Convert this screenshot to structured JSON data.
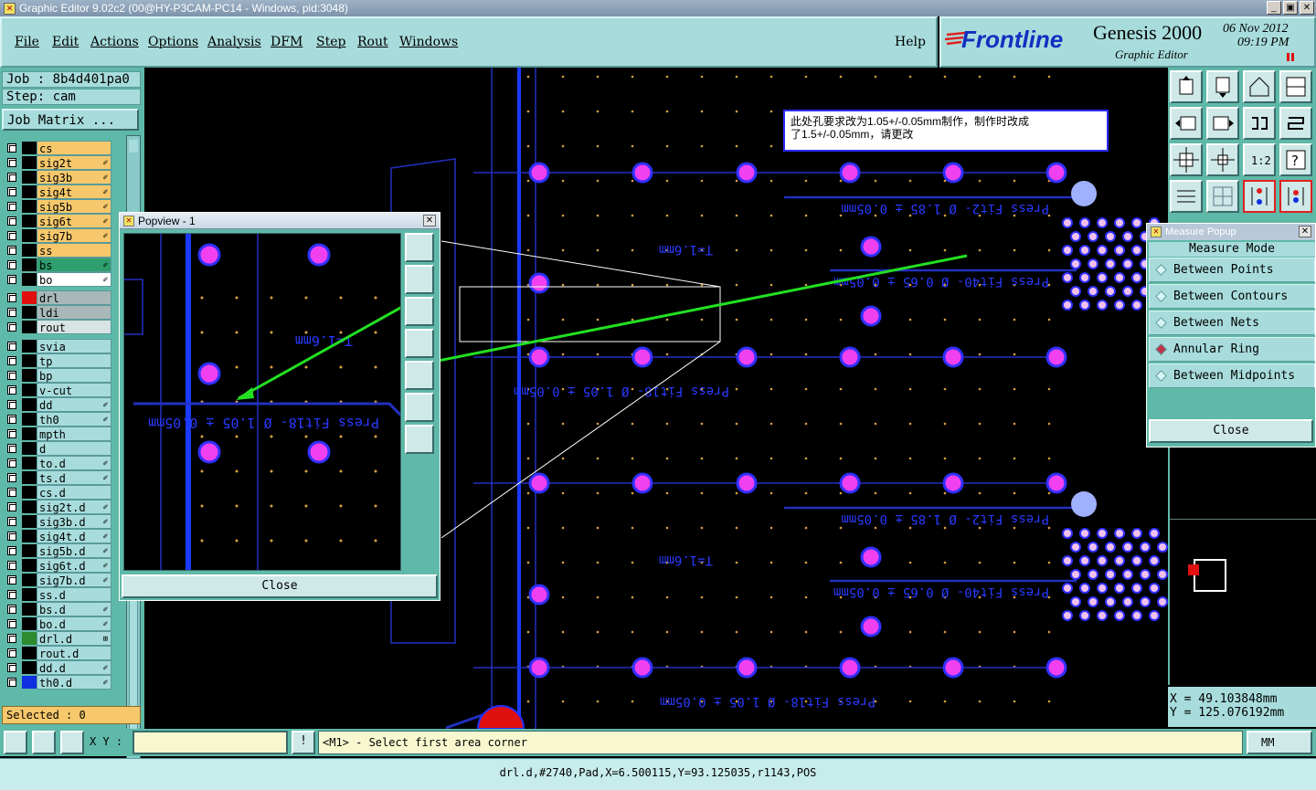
{
  "window": {
    "title": "Graphic Editor 9.02c2 (00@HY-P3CAM-PC14 - Windows, pid:3048)",
    "buttons": [
      "_",
      "▣",
      "✕"
    ]
  },
  "menu": {
    "items": [
      "File",
      "Edit",
      "Actions",
      "Options",
      "Analysis",
      "DFM",
      "Step",
      "Rout",
      "Windows"
    ],
    "help": "Help"
  },
  "brand": {
    "logo": "Frontline",
    "product": "Genesis 2000",
    "subtitle": "Graphic Editor",
    "date": "06 Nov 2012",
    "time": "09:19 PM"
  },
  "job": {
    "job_label": "Job : 8b4d401pa0",
    "step_label": "Step: cam",
    "matrix_button": "Job Matrix ..."
  },
  "layers": [
    {
      "name": "cs",
      "color": "#f7c86b",
      "swatch": "#000",
      "mark": ""
    },
    {
      "name": "sig2t",
      "color": "#f7c86b",
      "swatch": "#000",
      "mark": "✐"
    },
    {
      "name": "sig3b",
      "color": "#f7c86b",
      "swatch": "#000",
      "mark": "✐"
    },
    {
      "name": "sig4t",
      "color": "#f7c86b",
      "swatch": "#000",
      "mark": "✐"
    },
    {
      "name": "sig5b",
      "color": "#f7c86b",
      "swatch": "#000",
      "mark": "✐"
    },
    {
      "name": "sig6t",
      "color": "#f7c86b",
      "swatch": "#000",
      "mark": "✐"
    },
    {
      "name": "sig7b",
      "color": "#f7c86b",
      "swatch": "#000",
      "mark": "✐"
    },
    {
      "name": "ss",
      "color": "#f7c86b",
      "swatch": "#000",
      "mark": ""
    },
    {
      "name": "bs",
      "color": "#2e9e6e",
      "swatch": "#000",
      "mark": "✐"
    },
    {
      "name": "bo",
      "color": "#ffffff",
      "swatch": "#000",
      "mark": "✐"
    },
    {
      "name": "drl",
      "color": "#a8b8b8",
      "swatch": "#e01010",
      "mark": ""
    },
    {
      "name": "ldi",
      "color": "#a8b8b8",
      "swatch": "#000",
      "mark": ""
    },
    {
      "name": "rout",
      "color": "#d8e4e4",
      "swatch": "#000",
      "mark": ""
    },
    {
      "name": "svia",
      "color": "#a8dcdc",
      "swatch": "#000",
      "mark": ""
    },
    {
      "name": "tp",
      "color": "#a8dcdc",
      "swatch": "#000",
      "mark": ""
    },
    {
      "name": "bp",
      "color": "#a8dcdc",
      "swatch": "#000",
      "mark": ""
    },
    {
      "name": "v-cut",
      "color": "#a8dcdc",
      "swatch": "#000",
      "mark": ""
    },
    {
      "name": "dd",
      "color": "#a8dcdc",
      "swatch": "#000",
      "mark": "✐"
    },
    {
      "name": "th0",
      "color": "#a8dcdc",
      "swatch": "#000",
      "mark": "✐"
    },
    {
      "name": "mpth",
      "color": "#a8dcdc",
      "swatch": "#000",
      "mark": ""
    },
    {
      "name": "d",
      "color": "#a8dcdc",
      "swatch": "#000",
      "mark": ""
    },
    {
      "name": "to.d",
      "color": "#a8dcdc",
      "swatch": "#000",
      "mark": "✐"
    },
    {
      "name": "ts.d",
      "color": "#a8dcdc",
      "swatch": "#000",
      "mark": "✐"
    },
    {
      "name": "cs.d",
      "color": "#a8dcdc",
      "swatch": "#000",
      "mark": ""
    },
    {
      "name": "sig2t.d",
      "color": "#a8dcdc",
      "swatch": "#000",
      "mark": "✐"
    },
    {
      "name": "sig3b.d",
      "color": "#a8dcdc",
      "swatch": "#000",
      "mark": "✐"
    },
    {
      "name": "sig4t.d",
      "color": "#a8dcdc",
      "swatch": "#000",
      "mark": "✐"
    },
    {
      "name": "sig5b.d",
      "color": "#a8dcdc",
      "swatch": "#000",
      "mark": "✐"
    },
    {
      "name": "sig6t.d",
      "color": "#a8dcdc",
      "swatch": "#000",
      "mark": "✐"
    },
    {
      "name": "sig7b.d",
      "color": "#a8dcdc",
      "swatch": "#000",
      "mark": "✐"
    },
    {
      "name": "ss.d",
      "color": "#a8dcdc",
      "swatch": "#000",
      "mark": ""
    },
    {
      "name": "bs.d",
      "color": "#a8dcdc",
      "swatch": "#000",
      "mark": "✐"
    },
    {
      "name": "bo.d",
      "color": "#a8dcdc",
      "swatch": "#000",
      "mark": "✐"
    },
    {
      "name": "drl.d",
      "color": "#a8dcdc",
      "swatch": "#2e8b2e",
      "mark": "⊞"
    },
    {
      "name": "rout.d",
      "color": "#a8dcdc",
      "swatch": "#000",
      "mark": ""
    },
    {
      "name": "dd.d",
      "color": "#a8dcdc",
      "swatch": "#000",
      "mark": "✐"
    },
    {
      "name": "th0.d",
      "color": "#a8dcdc",
      "swatch": "#1030e0",
      "mark": "✐"
    }
  ],
  "selected": "Selected : 0",
  "note": {
    "line1": "此处孔要求改为1.05+/-0.05mm制作，制作时改成",
    "line2": "了1.5+/-0.05mm，请更改"
  },
  "canvas_labels": {
    "press_fit_2": "Press Fit2- Ø 1.85 ± 0.05mm",
    "press_fit_40": "Press Fit40- Ø 0.65 ± 0.05mm",
    "press_fit_18": "Press Fit18- Ø 1.05 ± 0.05mm",
    "thickness": "T=1.6mm"
  },
  "popview": {
    "title": "Popview - 1",
    "close": "Close"
  },
  "measure": {
    "title": "Measure Popup",
    "mode_label": "Measure Mode",
    "options": [
      "Between Points",
      "Between Contours",
      "Between Nets",
      "Annular Ring",
      "Between Midpoints"
    ],
    "selected": "Annular Ring",
    "close": "Close"
  },
  "coords": {
    "x": "X  =  49.103848mm",
    "y": "Y  = 125.076192mm"
  },
  "bottom": {
    "xy_label": "X Y :",
    "xy_value": "",
    "info_button": "!",
    "prompt": "<M1> - Select first area corner",
    "units": "MM"
  },
  "status": "drl.d,#2740,Pad,X=6.500115,Y=93.125035,r1143,POS"
}
